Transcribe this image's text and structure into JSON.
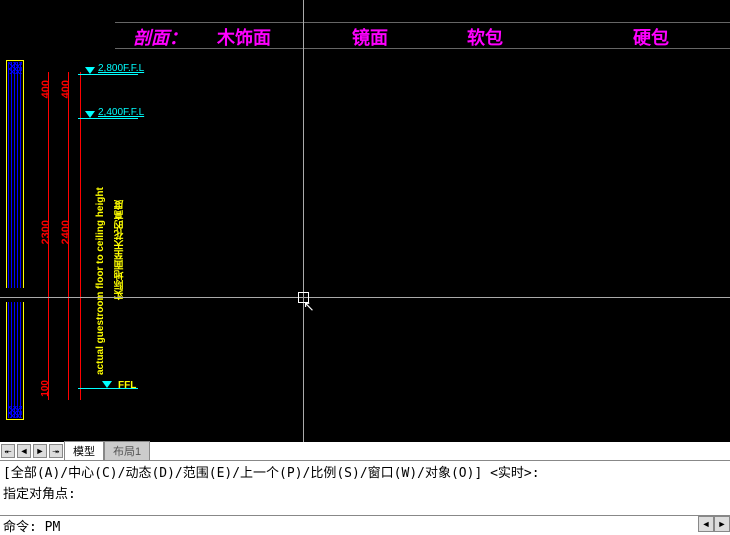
{
  "header": {
    "label": "剖面：",
    "items": [
      "木饰面",
      "镜面",
      "软包",
      "硬包"
    ]
  },
  "levels": {
    "top": "2,800F.F.L",
    "mid": "2,400F.F.L",
    "ffl": "FFL"
  },
  "dims": {
    "d400a": "400",
    "d400b": "400",
    "d2300": "2300",
    "d2400": "2400",
    "d100": "100"
  },
  "notes": {
    "en": "actual guestroom floor to ceiling height",
    "zh": "实际地面至天花的高度"
  },
  "tabs": {
    "model": "模型",
    "layout": "布局1"
  },
  "command": {
    "history1": "[全部(A)/中心(C)/动态(D)/范围(E)/上一个(P)/比例(S)/窗口(W)/对象(O)] <实时>:",
    "history2": "指定对角点:",
    "prompt": "命令: PM"
  }
}
